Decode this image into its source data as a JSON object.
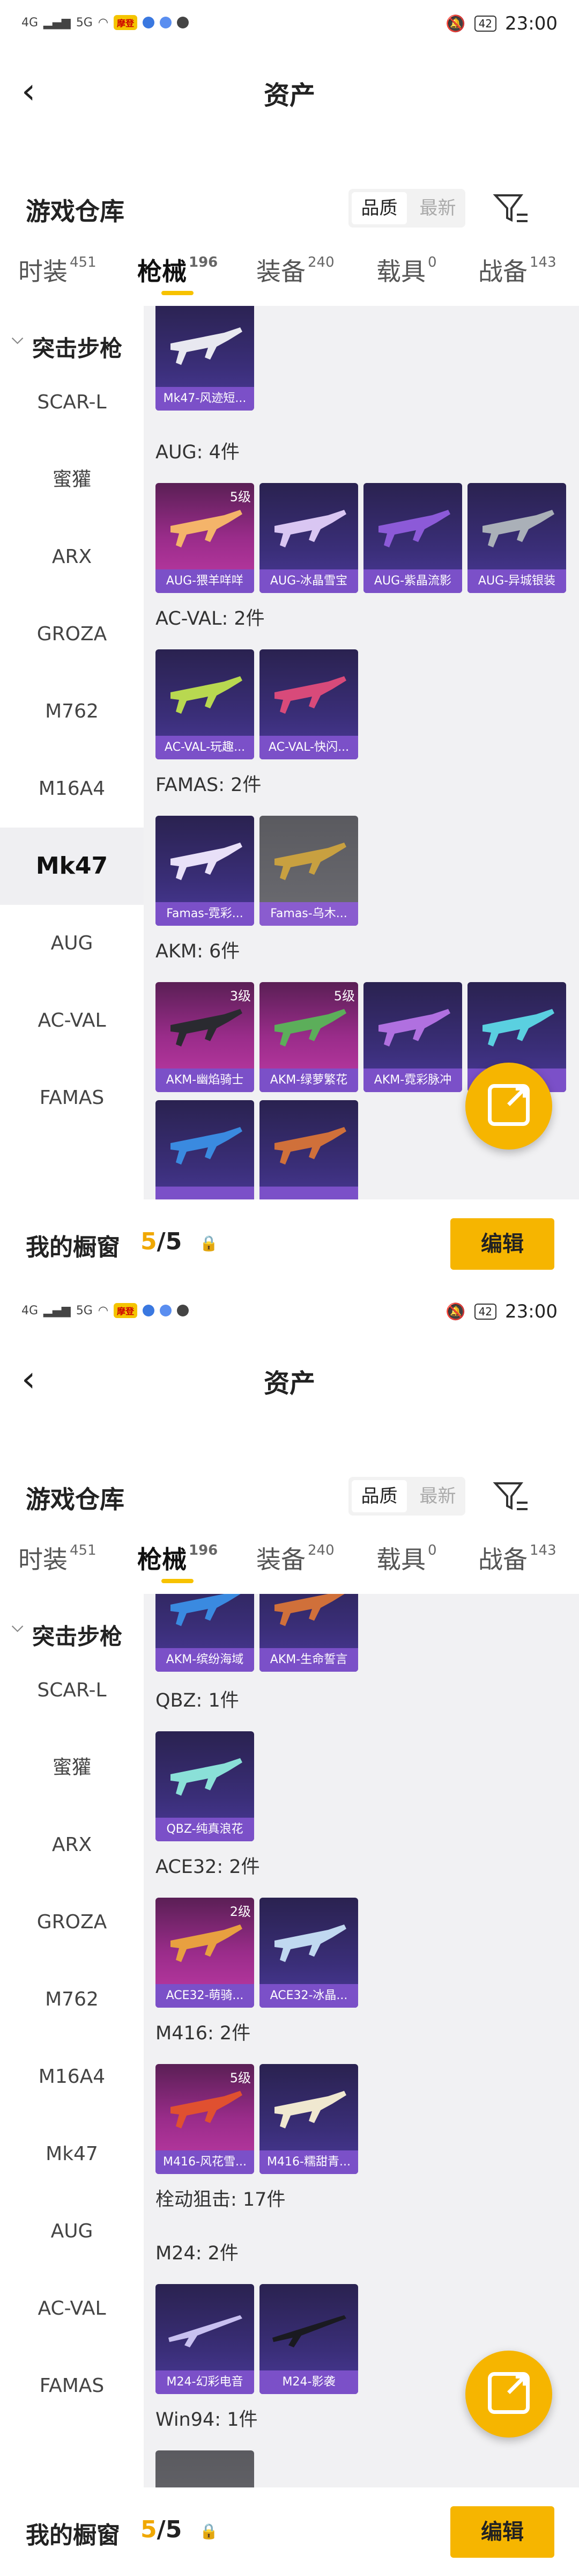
{
  "status": {
    "network": "4G",
    "signal": "5G",
    "badge": "摩登",
    "time": "23:00",
    "battery": "42"
  },
  "header": {
    "back_icon": "‹",
    "title": "资产"
  },
  "warehouse": {
    "title": "游戏仓库",
    "sort_quality": "品质",
    "sort_latest": "最新"
  },
  "tabs": [
    {
      "label": "时装",
      "count": "451"
    },
    {
      "label": "枪械",
      "count": "196"
    },
    {
      "label": "装备",
      "count": "240"
    },
    {
      "label": "载具",
      "count": "0"
    },
    {
      "label": "战备",
      "count": "143"
    }
  ],
  "sidebar": {
    "header": "突击步枪",
    "items": [
      "SCAR-L",
      "蜜獾",
      "ARX",
      "GROZA",
      "M762",
      "M16A4",
      "Mk47",
      "AUG",
      "AC-VAL",
      "FAMAS"
    ]
  },
  "screen1": {
    "selected_item": "Mk47",
    "top_card": {
      "name": "Mk47-风迹短..."
    },
    "sections": [
      {
        "title": "AUG: 4件",
        "cards": [
          {
            "name": "AUG-猥羊咩咩",
            "level": "5级",
            "style": "pink"
          },
          {
            "name": "AUG-冰晶雪宝",
            "level": "",
            "style": "purple"
          },
          {
            "name": "AUG-紫晶流影",
            "level": "",
            "style": "purple"
          },
          {
            "name": "AUG-异城银装",
            "level": "",
            "style": "purple"
          }
        ]
      },
      {
        "title": "AC-VAL: 2件",
        "cards": [
          {
            "name": "AC-VAL-玩趣...",
            "level": "",
            "style": "purple"
          },
          {
            "name": "AC-VAL-快闪...",
            "level": "",
            "style": "purple"
          }
        ]
      },
      {
        "title": "FAMAS: 2件",
        "cards": [
          {
            "name": "Famas-霓彩...",
            "level": "",
            "style": "purple"
          },
          {
            "name": "Famas-乌木...",
            "level": "",
            "style": "grey"
          }
        ]
      },
      {
        "title": "AKM: 6件",
        "cards": [
          {
            "name": "AKM-幽焰骑士",
            "level": "3级",
            "style": "pink"
          },
          {
            "name": "AKM-绿萝繁花",
            "level": "5级",
            "style": "pink"
          },
          {
            "name": "AKM-霓彩脉冲",
            "level": "",
            "style": "purple"
          },
          {
            "name": "...",
            "level": "",
            "style": "purple"
          }
        ]
      }
    ],
    "bottom_row": [
      {
        "name": "...",
        "level": "",
        "style": "purple"
      },
      {
        "name": "...",
        "level": "",
        "style": "purple"
      }
    ]
  },
  "screen2": {
    "top_cards": [
      {
        "name": "AKM-缤纷海域"
      },
      {
        "name": "AKM-生命誓言"
      }
    ],
    "sections": [
      {
        "title": "QBZ: 1件",
        "cards": [
          {
            "name": "QBZ-纯真浪花",
            "level": "",
            "style": "purple"
          }
        ]
      },
      {
        "title": "ACE32: 2件",
        "cards": [
          {
            "name": "ACE32-萌骑...",
            "level": "2级",
            "style": "pink"
          },
          {
            "name": "ACE32-冰晶...",
            "level": "",
            "style": "purple"
          }
        ]
      },
      {
        "title": "M416: 2件",
        "cards": [
          {
            "name": "M416-风花雪...",
            "level": "5级",
            "style": "pink"
          },
          {
            "name": "M416-糯甜青...",
            "level": "",
            "style": "purple"
          }
        ]
      },
      {
        "title": "栓动狙击: 17件",
        "cards": []
      },
      {
        "title": "M24: 2件",
        "cards": [
          {
            "name": "M24-幻彩电音",
            "level": "",
            "style": "purple"
          },
          {
            "name": "M24-影袭",
            "level": "",
            "style": "purple"
          }
        ]
      },
      {
        "title": "Win94: 1件",
        "cards": []
      }
    ]
  },
  "bottom": {
    "label": "我的橱窗",
    "count_current": "5",
    "count_total": "/5",
    "edit_label": "编辑"
  },
  "colors": {
    "accent": "#f6b500",
    "card_label": "#7b50c8"
  }
}
